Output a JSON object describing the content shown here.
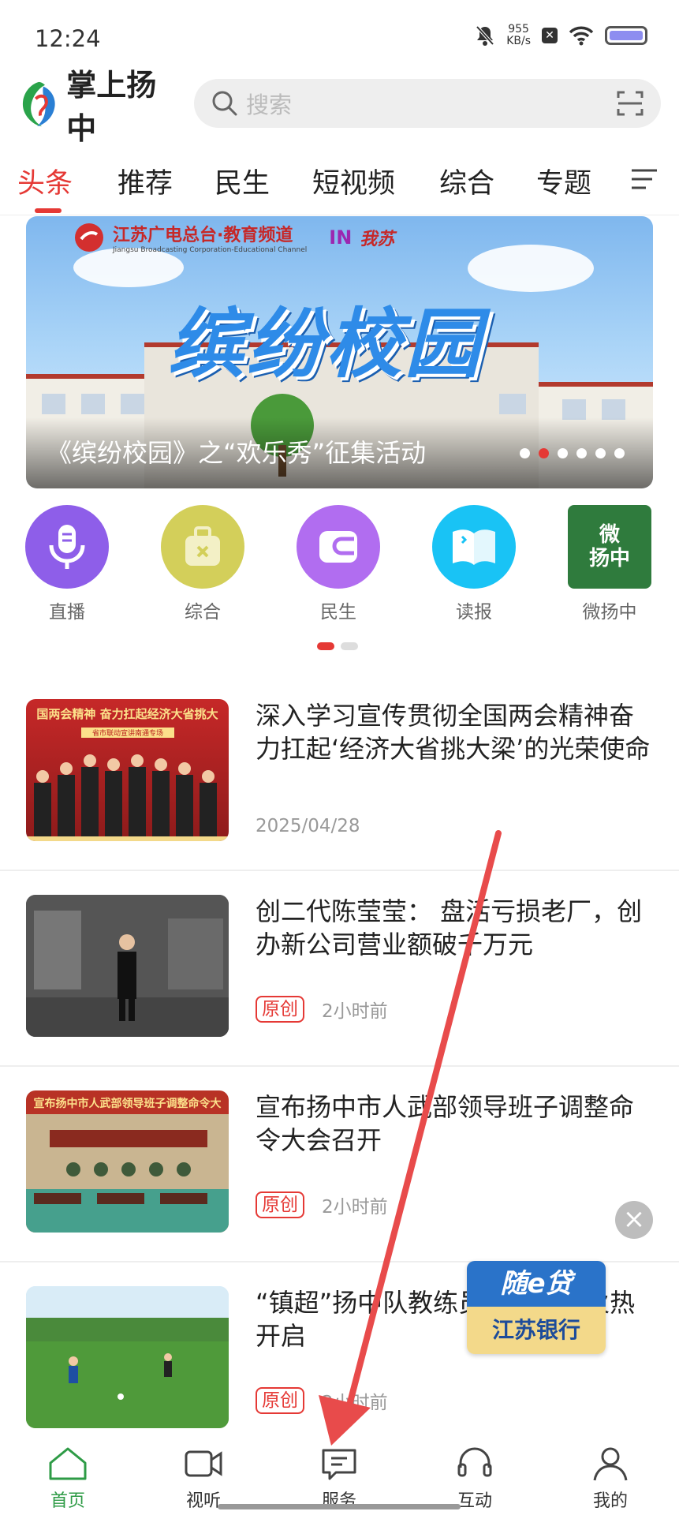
{
  "status": {
    "time": "12:24",
    "net_speed": "955",
    "net_unit": "KB/s"
  },
  "header": {
    "app_name": "掌上扬中",
    "search_placeholder": "搜索"
  },
  "tabs": [
    "头条",
    "推荐",
    "民生",
    "短视频",
    "综合",
    "专题"
  ],
  "active_tab": 0,
  "banner": {
    "header_text": "江苏广电总台·教育频道",
    "header_sub": "Jiangsu Broadcasting Corporation-Educational Channel",
    "brand": "我苏",
    "art_title": "缤纷校园",
    "caption": "《缤纷校园》之“欢乐秀”征集活动",
    "slide_count": 6,
    "active_slide": 1
  },
  "quick_links": [
    {
      "label": "直播",
      "color": "#8e5ee9",
      "icon": "microphone-icon"
    },
    {
      "label": "综合",
      "color": "#d3cf5a",
      "icon": "briefcase-icon"
    },
    {
      "label": "民生",
      "color": "#b16df0",
      "icon": "wallet-icon"
    },
    {
      "label": "读报",
      "color": "#19c3f5",
      "icon": "book-icon"
    },
    {
      "label": "微扬中",
      "logo_text": "微扬中",
      "icon": "weiyangzhong-logo"
    }
  ],
  "news": [
    {
      "title": "深入学习宣传贯彻全国两会精神奋力扛起‘经济大省挑大梁’的光荣使命",
      "date": "2025/04/28",
      "thumb_text": "国两会精神  奋力扛起经济大省挑大",
      "thumb_sub": "省市联动宣讲南通专场"
    },
    {
      "title": "创二代陈莹莹：  盘活亏损老厂，创办新公司营业额破千万元",
      "tag": "原创",
      "time": "2小时前"
    },
    {
      "title": "宣布扬中市人武部领导班子调整命令大会召开",
      "tag": "原创",
      "time": "2小时前",
      "thumb_text": "宣布扬中市人武部领导班子调整命令大"
    },
    {
      "title": "“镇超”扬中队教练员选拔试训火热开启",
      "tag": "原创",
      "time": "2小时前"
    }
  ],
  "ad": {
    "top": "随e贷",
    "bottom": "江苏银行"
  },
  "bottom_nav": [
    {
      "label": "首页",
      "icon": "home-icon"
    },
    {
      "label": "视听",
      "icon": "video-icon"
    },
    {
      "label": "服务",
      "icon": "service-icon"
    },
    {
      "label": "互动",
      "icon": "headset-icon"
    },
    {
      "label": "我的",
      "icon": "user-icon"
    }
  ],
  "colors": {
    "accent": "#e53935",
    "nav_active": "#2e9b46"
  }
}
